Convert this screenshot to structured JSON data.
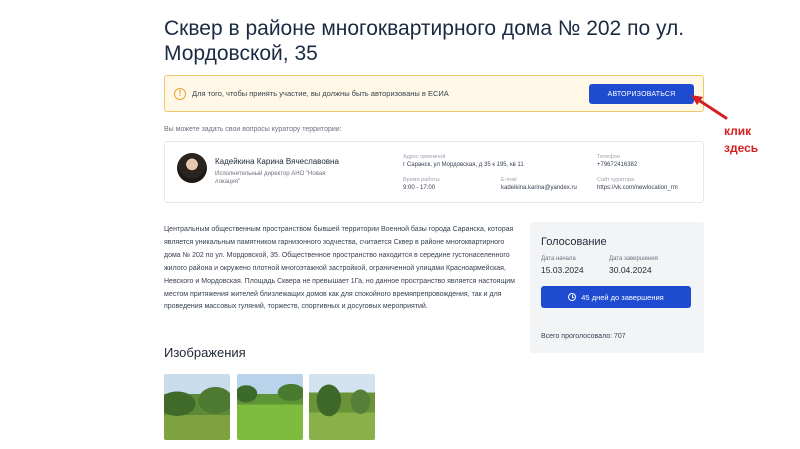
{
  "page": {
    "title": "Сквер в районе многоквартирного дома № 202 по ул. Мордовской, 35"
  },
  "alert": {
    "icon": "warning-circle-icon",
    "text": "Для того, чтобы принять участие, вы должны быть авторизованы в ЕСИА",
    "button_label": "АВТОРИЗОВАТЬСЯ",
    "button_color": "#1f4bd1",
    "background": "#fff8e6",
    "border": "#f2c76b"
  },
  "annotation": {
    "text_line1": "клик",
    "text_line2": "здесь",
    "color": "#d32020"
  },
  "curator": {
    "caption": "Вы можете задать свои вопросы куратору территории:",
    "name": "Кадейкина Карина Вячеславовна",
    "role": "Исполнительный директор АНО \"Новая локация\"",
    "address_label": "Адрес приемной",
    "address_value": "г Саранск, ул Мордовская, д 35 к 195, кв 11",
    "hours_label": "Время работы",
    "hours_value": "9:00 - 17:00",
    "phone_label": "Телефон",
    "phone_value": "+79672416382",
    "email_label": "E-mail",
    "email_value": "kadeikina.karina@yandex.ru",
    "site_label": "Сайт куратора",
    "site_value": "https://vk.com/newlocation_rm"
  },
  "description": "Центральным общественным пространством бывшей территории Военной базы города Саранска, которая является уникальным памятником гарнизонного зодчества, считается Сквер в районе многоквартирного дома № 202 по ул. Мордовской, 35. Общественное пространство находится в середине густонаселенного жилого района и окружено плотной многоэтажной застройкой, ограниченной улицами Красноармейская, Невского и Мордовская. Площадь Сквера не превышает 1Га, но данное пространство является настоящим местом притяжения жителей близлежащих домов как для спокойного времяпрепровождения, так и для проведения массовых гуляний, торжеств, спортивных и досуговых мероприятий.",
  "vote": {
    "title": "Голосование",
    "start_label": "Дата начала",
    "start_date": "15.03.2024",
    "end_label": "Дата завершения",
    "end_date": "30.04.2024",
    "days_left": "45 дней до завершения",
    "days_icon": "clock-icon",
    "total_votes": "Всего проголосовало: 707"
  },
  "images": {
    "title": "Изображения",
    "items": [
      "park-photo",
      "park-photo",
      "park-photo"
    ]
  }
}
